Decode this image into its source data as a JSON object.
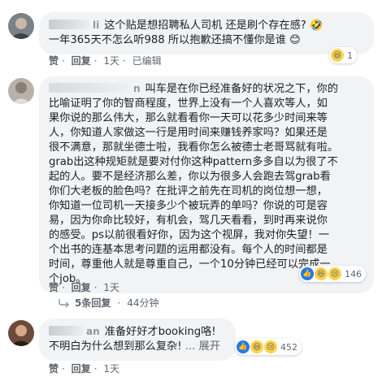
{
  "comments": [
    {
      "author_tail": "li",
      "text": "这个贴是想招聘私人司机 还是刷个存在感? 🤣 一年365天不怎么听988 所以抱歉还搞不懂你是谁 😊",
      "line1": "这个贴是想招聘私人司机 还是刷个存在感?",
      "line2": "一年365天不怎么听988 所以抱歉还搞不懂你是谁",
      "like": "赞",
      "reply": "回复",
      "time": "1天",
      "edited": "已编辑",
      "reaction_count": "1"
    },
    {
      "author_tail": "n",
      "text_lines": [
        "叫车是在你已经准备好的状况之下，你的",
        "比喻证明了你的智商程度，世界上没有一个人喜欢等人，如",
        "果你说的那么伟大，那么就看看你一天可以花多少时间来等",
        "人，你知道人家做这一行是用时间来赚钱养家吗？如果还是",
        "很不满意，那就坐德士啦，我看你怎么被德士老哥骂就有啦。",
        "grab出这种规矩就是要对付你这种pattern多多自以为很了不",
        "起的人。要不是经济那么差，你以为很多人会跑去驾grab看",
        "你们大老板的脸色吗？在批评之前先在司机的岗位想一想，",
        "你知道一位司机一天接多少个被玩弄的单吗？你说的可是容",
        "易，因为你命比较好，有机会，驾几天看看，到时再来说你",
        "的感受。ps以前很看好你，因为这个视屏，我对你失望！一",
        "个出书的连基本思考问题的运用都没有。每个人的时间都是",
        "时间，尊重他人就是尊重自己，一个10分钟已经可以完成一",
        "个job。"
      ],
      "like": "赞",
      "reply": "回复",
      "time": "1天",
      "reaction_count": "146"
    },
    {
      "author_tail": "an",
      "line1": "准备好好才booking咯!",
      "line2": "不明白为什么想到那么复杂!",
      "expand": "... 展开",
      "like": "赞",
      "reply": "回复",
      "time": "1天",
      "reaction_count": "452"
    }
  ],
  "replies": {
    "label": "5条回复",
    "time": "44分钟"
  },
  "colors": {
    "bubble": "#f2f3f5",
    "meta": "#606770",
    "like_blue": "#2078f4",
    "emoji_yellow": "#fcd34a"
  }
}
